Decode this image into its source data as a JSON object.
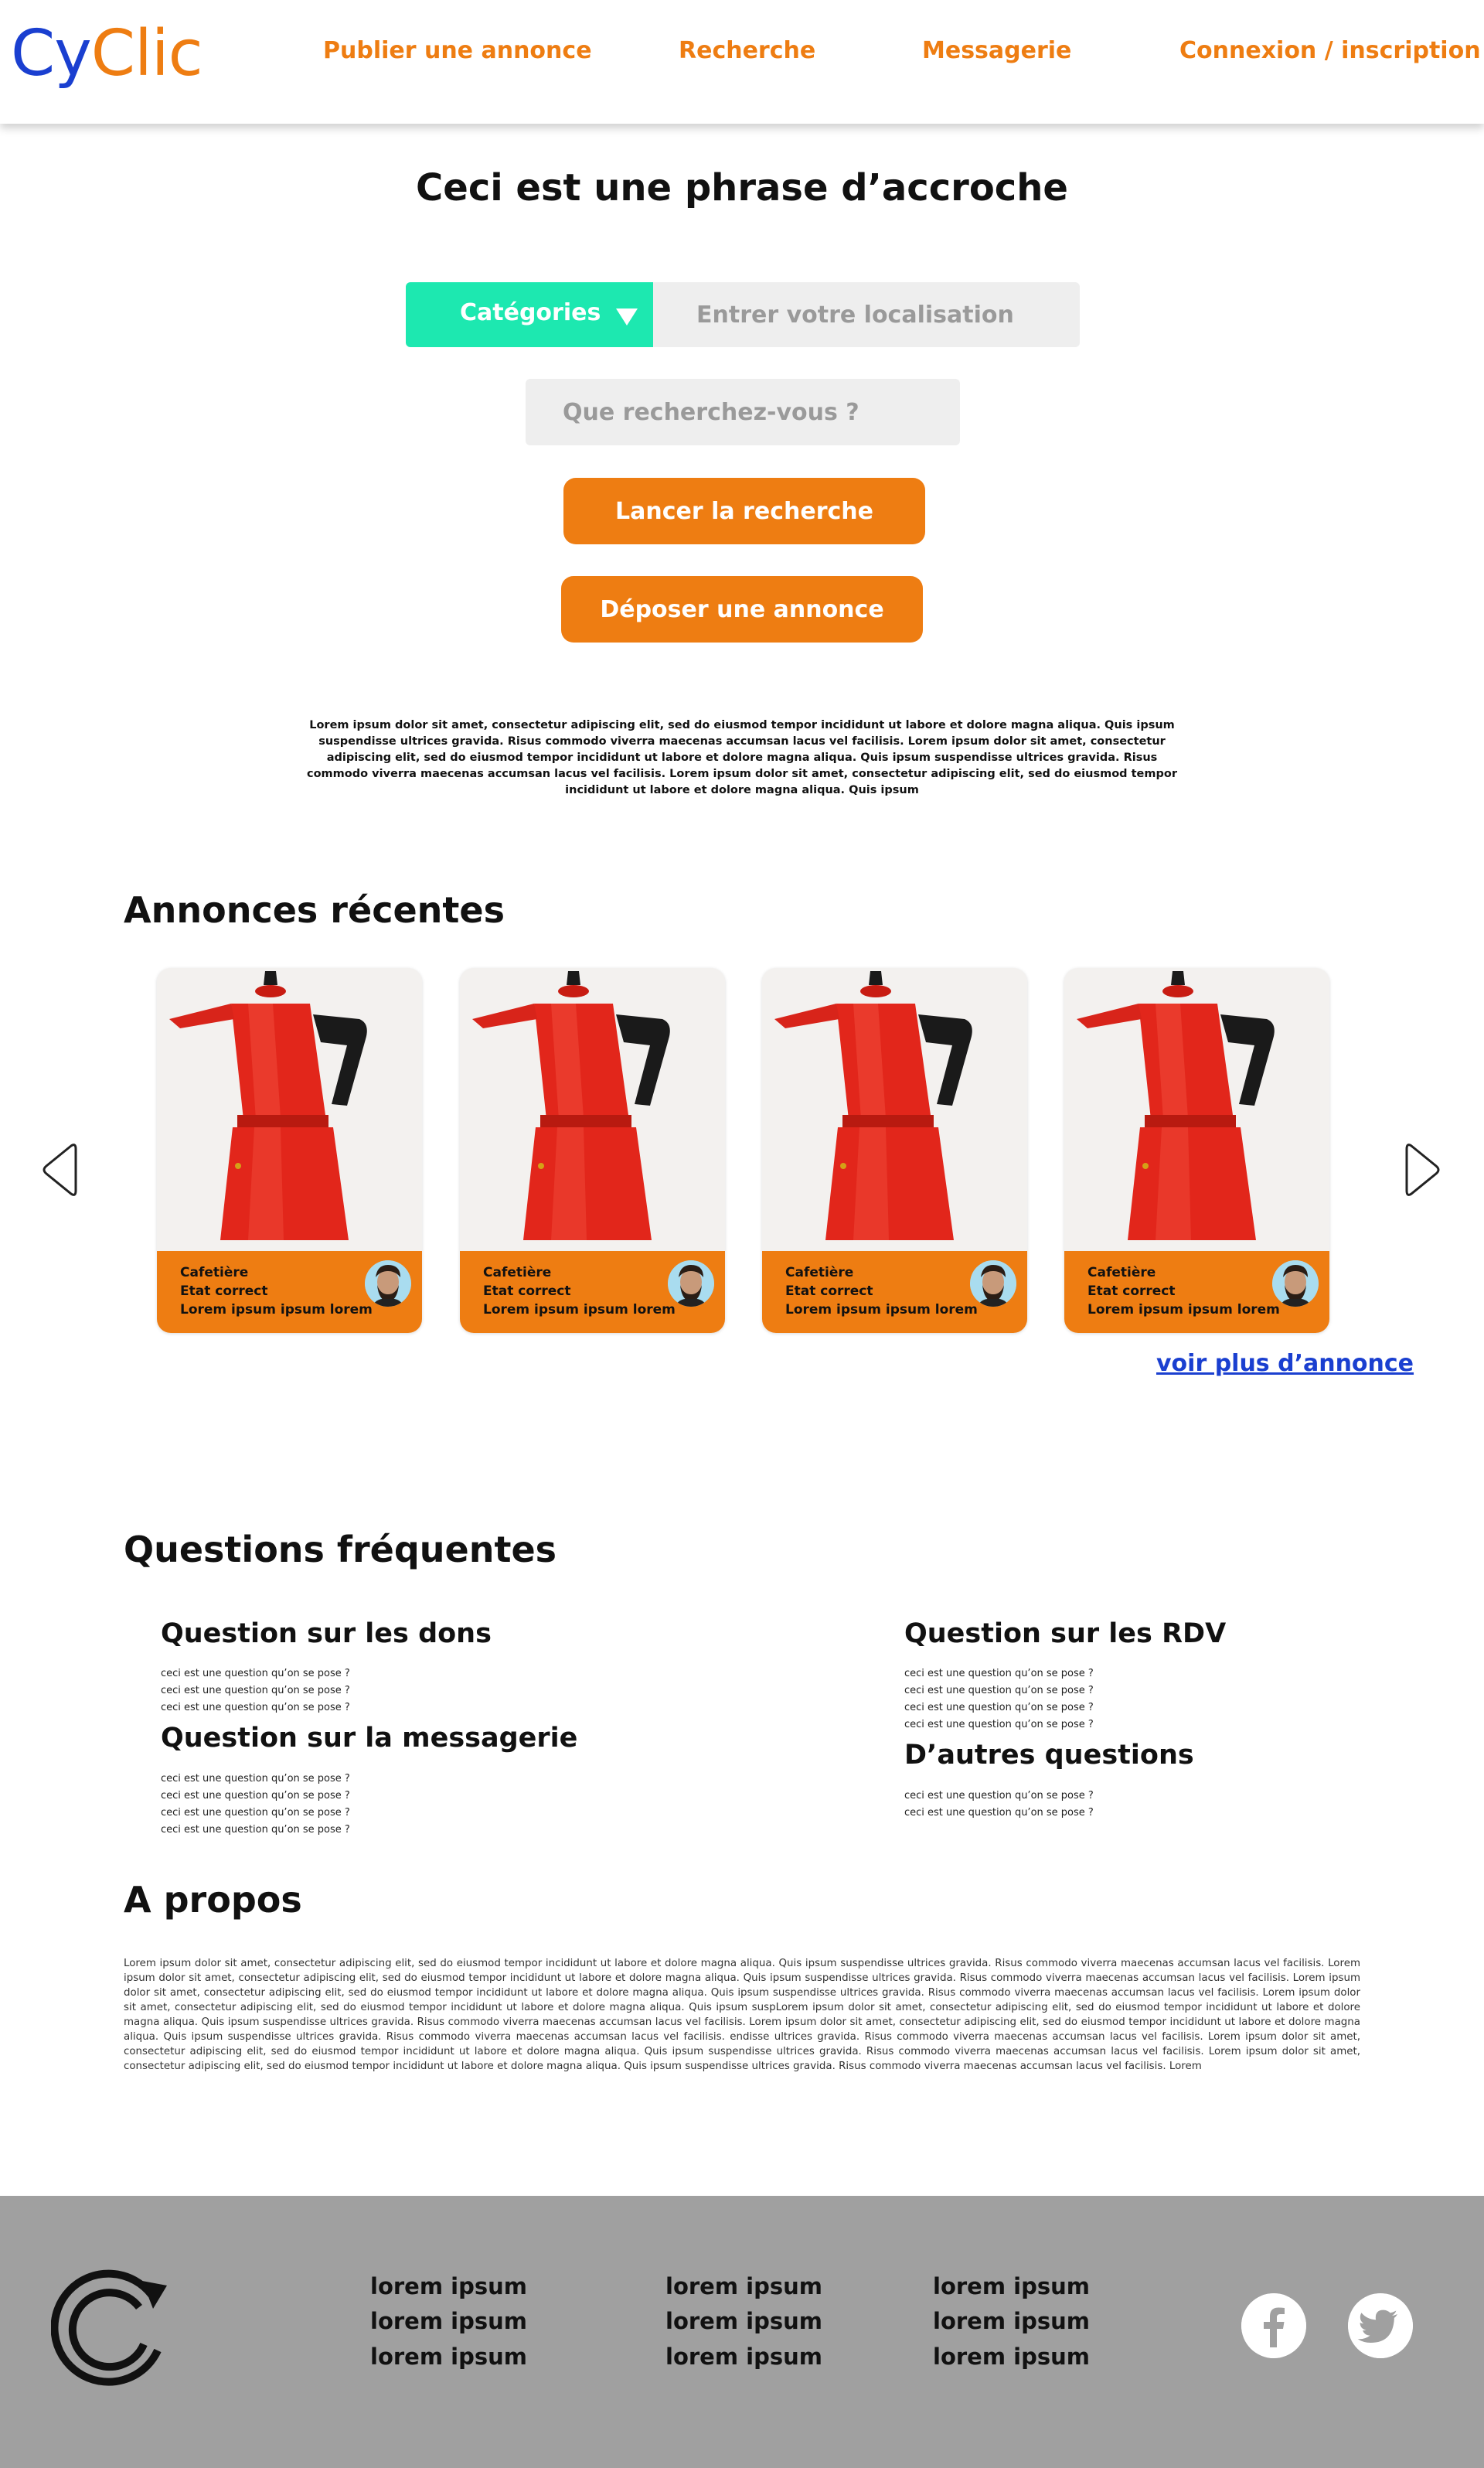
{
  "header": {
    "logo_part1": "Cy",
    "logo_part2": "Clic",
    "nav": [
      "Publier une annonce",
      "Recherche",
      "Messagerie",
      "Connexion / inscription"
    ]
  },
  "hero": {
    "tagline": "Ceci est une phrase d’accroche",
    "categories_label": "Catégories",
    "location_placeholder": "Entrer votre localisation",
    "search_placeholder": "Que recherchez-vous ?",
    "search_button": "Lancer la recherche",
    "post_button": "Déposer une annonce",
    "intro": "Lorem ipsum dolor sit amet, consectetur adipiscing elit, sed do eiusmod tempor incididunt ut labore et dolore magna aliqua. Quis ipsum suspendisse ultrices gravida. Risus commodo viverra maecenas accumsan lacus vel facilisis. Lorem ipsum dolor sit amet, consectetur adipiscing elit, sed do eiusmod tempor incididunt ut labore et dolore magna aliqua. Quis ipsum suspendisse ultrices gravida. Risus commodo viverra maecenas accumsan lacus vel facilisis. Lorem ipsum dolor sit amet, consectetur adipiscing elit, sed do eiusmod tempor incididunt ut labore et dolore magna aliqua. Quis ipsum"
  },
  "recent": {
    "title": "Annonces récentes",
    "cards": [
      {
        "line1": "Cafetière",
        "line2": "Etat correct",
        "line3": "Lorem ipsum ipsum lorem"
      },
      {
        "line1": "Cafetière",
        "line2": "Etat correct",
        "line3": "Lorem ipsum ipsum lorem"
      },
      {
        "line1": "Cafetière",
        "line2": "Etat correct",
        "line3": "Lorem ipsum ipsum lorem"
      },
      {
        "line1": "Cafetière",
        "line2": "Etat correct",
        "line3": "Lorem ipsum ipsum lorem"
      }
    ],
    "more_link": "voir plus d’annonce"
  },
  "faq": {
    "title": "Questions fréquentes",
    "groups": [
      {
        "title": "Question sur les dons",
        "questions": [
          "ceci est une question qu’on se pose ?",
          "ceci est une question qu’on se pose ?",
          "ceci est une question qu’on se pose ?"
        ]
      },
      {
        "title": "Question sur la messagerie",
        "questions": [
          "ceci est une question qu’on se pose ?",
          "ceci est une question qu’on se pose ?",
          "ceci est une question qu’on se pose ?",
          "ceci est une question qu’on se pose ?"
        ]
      },
      {
        "title": "Question sur les RDV",
        "questions": [
          "ceci est une question qu’on se pose ?",
          "ceci est une question qu’on se pose ?",
          "ceci est une question qu’on se pose ?",
          "ceci est une question qu’on se pose ?"
        ]
      },
      {
        "title": "D’autres questions",
        "questions": [
          "ceci est une question qu’on se pose ?",
          "ceci est une question qu’on se pose ?"
        ]
      }
    ]
  },
  "about": {
    "title": "A propos",
    "text": "Lorem ipsum dolor sit amet, consectetur adipiscing elit, sed do eiusmod tempor incididunt ut labore et dolore magna aliqua. Quis ipsum suspendisse ultrices gravida. Risus commodo viverra maecenas accumsan lacus vel facilisis. Lorem ipsum dolor sit amet, consectetur adipiscing elit, sed do eiusmod tempor incididunt ut labore et dolore magna aliqua. Quis ipsum suspendisse ultrices gravida. Risus commodo viverra maecenas accumsan lacus vel facilisis. Lorem ipsum dolor sit amet, consectetur adipiscing elit, sed do eiusmod tempor incididunt ut labore et dolore magna aliqua. Quis ipsum suspendisse ultrices gravida. Risus commodo viverra maecenas accumsan lacus vel facilisis. Lorem ipsum dolor sit amet, consectetur adipiscing elit, sed do eiusmod tempor incididunt ut labore et dolore magna aliqua. Quis ipsum suspLorem ipsum dolor sit amet, consectetur adipiscing elit, sed do eiusmod tempor incididunt ut labore et dolore magna aliqua. Quis ipsum suspendisse ultrices gravida. Risus commodo viverra maecenas accumsan lacus vel facilisis. Lorem ipsum dolor sit amet, consectetur adipiscing elit, sed do eiusmod tempor incididunt ut labore et dolore magna aliqua. Quis ipsum suspendisse ultrices gravida. Risus commodo viverra maecenas accumsan lacus vel facilisis. endisse ultrices gravida. Risus commodo viverra maecenas accumsan lacus vel facilisis. Lorem ipsum dolor sit amet, consectetur adipiscing elit, sed do eiusmod tempor incididunt ut labore et dolore magna aliqua. Quis ipsum suspendisse ultrices gravida. Risus commodo viverra maecenas accumsan lacus vel facilisis. Lorem ipsum dolor sit amet, consectetur adipiscing elit, sed do eiusmod tempor incididunt ut labore et dolore magna aliqua. Quis ipsum suspendisse ultrices gravida. Risus commodo viverra maecenas accumsan lacus vel facilisis. Lorem"
  },
  "footer": {
    "columns": [
      [
        "lorem ipsum",
        "lorem ipsum",
        "lorem ipsum"
      ],
      [
        "lorem ipsum",
        "lorem ipsum",
        "lorem ipsum"
      ],
      [
        "lorem ipsum",
        "lorem ipsum",
        "lorem ipsum"
      ]
    ],
    "social": [
      "facebook-icon",
      "twitter-icon"
    ]
  },
  "colors": {
    "brand_blue": "#1a3fd0",
    "brand_orange": "#ee7d12",
    "accent_teal": "#1de8b0",
    "footer_gray": "#a0a0a0"
  }
}
